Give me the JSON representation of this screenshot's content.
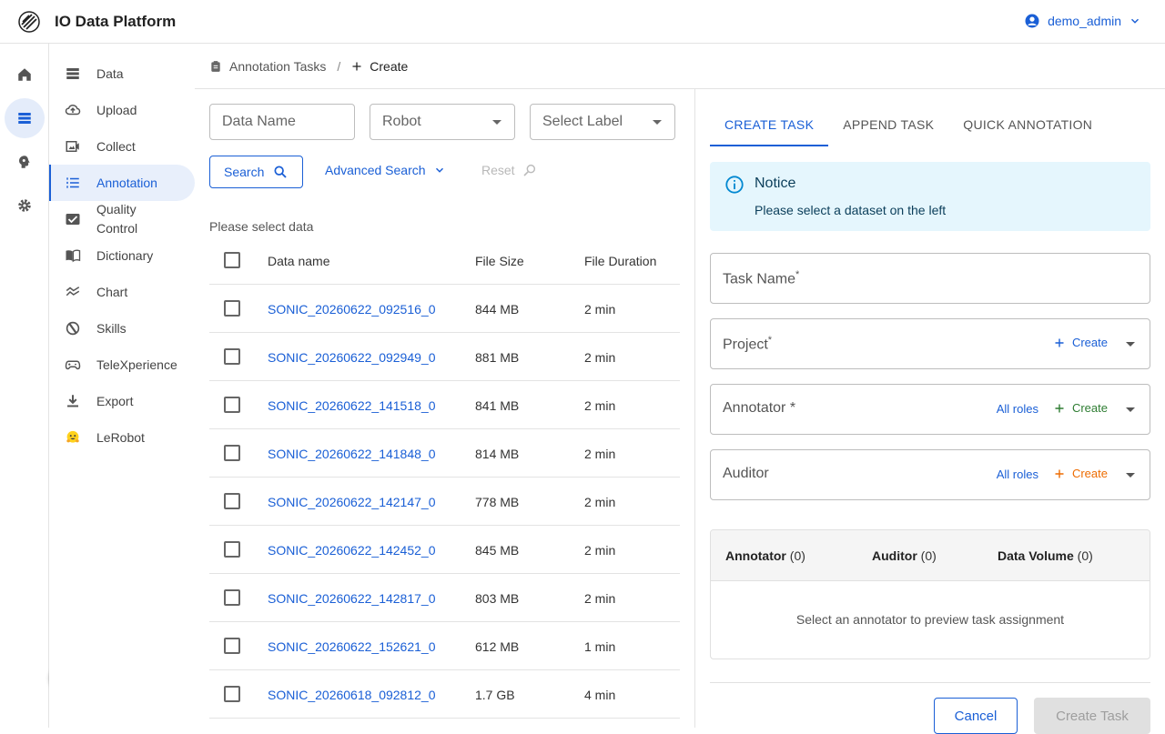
{
  "app": {
    "title": "IO Data Platform"
  },
  "user": {
    "name": "demo_admin"
  },
  "rail": [
    "home-icon",
    "list-icon",
    "brain-icon",
    "gear-icon"
  ],
  "sidebar": {
    "items": [
      {
        "label": "Data",
        "icon": "database-icon"
      },
      {
        "label": "Upload",
        "icon": "cloud-upload-icon"
      },
      {
        "label": "Collect",
        "icon": "video-icon"
      },
      {
        "label": "Annotation",
        "icon": "numbered-list-icon",
        "active": true
      },
      {
        "label": "Quality Control",
        "icon": "photo-check-icon"
      },
      {
        "label": "Dictionary",
        "icon": "book-icon"
      },
      {
        "label": "Chart",
        "icon": "wave-icon"
      },
      {
        "label": "Skills",
        "icon": "badge-icon"
      },
      {
        "label": "TeleXperience",
        "icon": "gamepad-icon"
      },
      {
        "label": "Export",
        "icon": "download-icon"
      },
      {
        "label": "LeRobot",
        "icon": "hugging-face-icon"
      }
    ]
  },
  "breadcrumb": {
    "parent": "Annotation Tasks",
    "separator": "/",
    "current": "Create"
  },
  "filters": {
    "data_name_placeholder": "Data Name",
    "robot": "Robot",
    "label": "Select Label",
    "search": "Search",
    "advanced": "Advanced Search",
    "reset": "Reset"
  },
  "hint": "Please select data",
  "table": {
    "columns": [
      "Data name",
      "File Size",
      "File Duration"
    ],
    "rows": [
      {
        "name": "SONIC_20260622_092516_0",
        "size": "844 MB",
        "duration": "2 min"
      },
      {
        "name": "SONIC_20260622_092949_0",
        "size": "881 MB",
        "duration": "2 min"
      },
      {
        "name": "SONIC_20260622_141518_0",
        "size": "841 MB",
        "duration": "2 min"
      },
      {
        "name": "SONIC_20260622_141848_0",
        "size": "814 MB",
        "duration": "2 min"
      },
      {
        "name": "SONIC_20260622_142147_0",
        "size": "778 MB",
        "duration": "2 min"
      },
      {
        "name": "SONIC_20260622_142452_0",
        "size": "845 MB",
        "duration": "2 min"
      },
      {
        "name": "SONIC_20260622_142817_0",
        "size": "803 MB",
        "duration": "2 min"
      },
      {
        "name": "SONIC_20260622_152621_0",
        "size": "612 MB",
        "duration": "1 min"
      },
      {
        "name": "SONIC_20260618_092812_0",
        "size": "1.7 GB",
        "duration": "4 min"
      }
    ]
  },
  "tabs": [
    "CREATE TASK",
    "APPEND TASK",
    "QUICK ANNOTATION"
  ],
  "notice": {
    "title": "Notice",
    "message": "Please select a dataset on the left"
  },
  "form": {
    "task_name": "Task Name",
    "project": "Project",
    "annotator": "Annotator",
    "auditor": "Auditor",
    "all_roles": "All roles",
    "create": "Create",
    "required": "*"
  },
  "assignment": {
    "annotator_label": "Annotator",
    "annotator_count": "(0)",
    "auditor_label": "Auditor",
    "auditor_count": "(0)",
    "volume_label": "Data Volume",
    "volume_count": "(0)",
    "empty": "Select an annotator to preview task assignment"
  },
  "actions": {
    "cancel": "Cancel",
    "create_task": "Create Task"
  },
  "colors": {
    "primary": "#1a5fd6",
    "green": "#2e7d32",
    "orange": "#ed6c02",
    "notice_bg": "#e5f6fd"
  }
}
